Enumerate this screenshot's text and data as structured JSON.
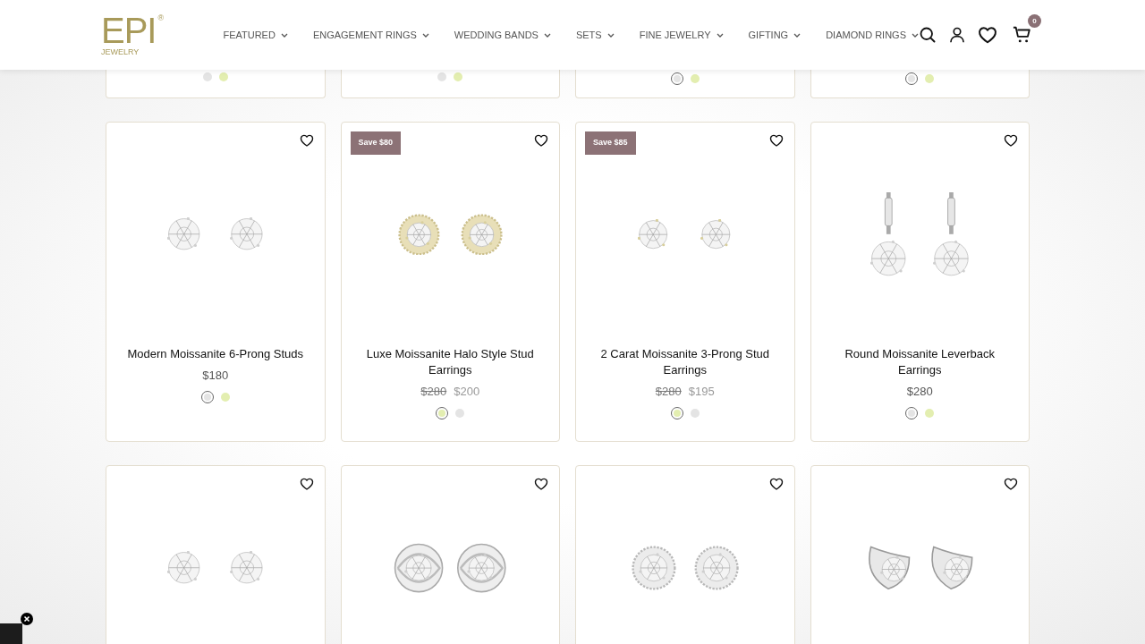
{
  "header": {
    "logo": {
      "text": "EPI",
      "mark": "®",
      "subtitle": "JEWELRY"
    },
    "nav": [
      "FEATURED",
      "ENGAGEMENT RINGS",
      "WEDDING BANDS",
      "SETS",
      "FINE JEWELRY",
      "GIFTING",
      "DIAMOND RINGS"
    ],
    "cart_count": "0"
  },
  "top_row": [
    {
      "swatches": [
        {
          "color": "#e4e4e4",
          "selected": false
        },
        {
          "color": "#e3eeb0",
          "selected": false
        }
      ]
    },
    {
      "swatches": [
        {
          "color": "#e4e4e4",
          "selected": false
        },
        {
          "color": "#e3eeb0",
          "selected": false
        }
      ]
    },
    {
      "swatches": [
        {
          "color": "#e4e4e4",
          "selected": true
        },
        {
          "color": "#e3eeb0",
          "selected": false
        }
      ]
    },
    {
      "swatches": [
        {
          "color": "#e4e4e4",
          "selected": true
        },
        {
          "color": "#e3eeb0",
          "selected": false
        }
      ]
    }
  ],
  "products": [
    {
      "kind": "stud",
      "name": "Modern Moissanite 6-Prong Studs",
      "price": "$180",
      "swatches": [
        {
          "color": "#e4e4e4",
          "selected": true
        },
        {
          "color": "#e3eeb0",
          "selected": false
        }
      ]
    },
    {
      "kind": "halo",
      "badge": "Save $80",
      "name": "Luxe Moissanite Halo Style Stud Earrings",
      "compare_price": "$280",
      "price": "$200",
      "swatches": [
        {
          "color": "#e3eeb0",
          "selected": true
        },
        {
          "color": "#e4e4e4",
          "selected": false
        }
      ]
    },
    {
      "kind": "stud-gold",
      "badge": "Save $85",
      "name": "2 Carat Moissanite 3-Prong Stud Earrings",
      "compare_price": "$280",
      "price": "$195",
      "swatches": [
        {
          "color": "#e3eeb0",
          "selected": true
        },
        {
          "color": "#e4e4e4",
          "selected": false
        }
      ]
    },
    {
      "kind": "leverback",
      "name": "Round Moissanite Leverback Earrings",
      "price": "$280",
      "swatches": [
        {
          "color": "#e4e4e4",
          "selected": true
        },
        {
          "color": "#e3eeb0",
          "selected": false
        }
      ]
    }
  ],
  "bottom_row": [
    {
      "kind": "stud"
    },
    {
      "kind": "swirl"
    },
    {
      "kind": "halo-silver"
    },
    {
      "kind": "crescent"
    }
  ]
}
